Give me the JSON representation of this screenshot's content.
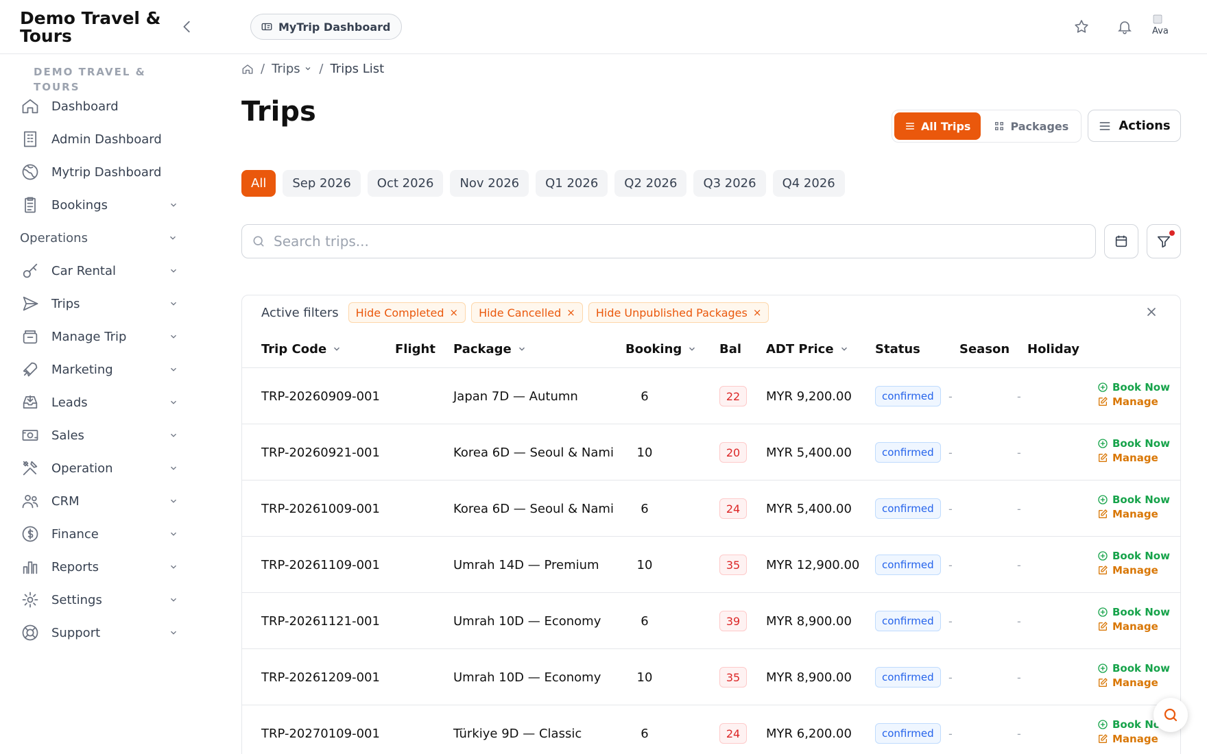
{
  "header": {
    "brand": "Demo Travel & Tours",
    "dashboard_pill": "MyTrip Dashboard",
    "avatar_text": "Ava"
  },
  "sidebar": {
    "org_label": "DEMO TRAVEL & TOURS",
    "items": [
      {
        "label": "Dashboard",
        "icon": "home-icon",
        "chevron": false
      },
      {
        "label": "Admin Dashboard",
        "icon": "building-icon",
        "chevron": false
      },
      {
        "label": "Mytrip Dashboard",
        "icon": "globe-icon",
        "chevron": false
      },
      {
        "label": "Bookings",
        "icon": "clipboard-icon",
        "chevron": true
      },
      {
        "label": "Operations",
        "icon": "",
        "chevron": true,
        "section": true
      },
      {
        "label": "Car Rental",
        "icon": "key-icon",
        "chevron": true
      },
      {
        "label": "Trips",
        "icon": "send-icon",
        "chevron": true
      },
      {
        "label": "Manage Trip",
        "icon": "archive-icon",
        "chevron": true
      },
      {
        "label": "Marketing",
        "icon": "rocket-icon",
        "chevron": true
      },
      {
        "label": "Leads",
        "icon": "inbox-icon",
        "chevron": true
      },
      {
        "label": "Sales",
        "icon": "money-icon",
        "chevron": true
      },
      {
        "label": "Operation",
        "icon": "tools-icon",
        "chevron": true
      },
      {
        "label": "CRM",
        "icon": "users-icon",
        "chevron": true
      },
      {
        "label": "Finance",
        "icon": "dollar-icon",
        "chevron": true
      },
      {
        "label": "Reports",
        "icon": "chart-icon",
        "chevron": true
      },
      {
        "label": "Settings",
        "icon": "gear-icon",
        "chevron": true
      },
      {
        "label": "Support",
        "icon": "lifebuoy-icon",
        "chevron": true
      }
    ]
  },
  "breadcrumb": {
    "trips": "Trips",
    "current": "Trips List"
  },
  "page": {
    "title": "Trips",
    "view_all": "All Trips",
    "view_packages": "Packages",
    "actions": "Actions"
  },
  "period_chips": [
    "All",
    "Sep 2026",
    "Oct 2026",
    "Nov 2026",
    "Q1 2026",
    "Q2 2026",
    "Q3 2026",
    "Q4 2026"
  ],
  "search": {
    "placeholder": "Search trips..."
  },
  "filters": {
    "label": "Active filters",
    "tags": [
      "Hide Completed",
      "Hide Cancelled",
      "Hide Unpublished Packages"
    ]
  },
  "table": {
    "headers": {
      "trip_code": "Trip Code",
      "flight": "Flight",
      "package": "Package",
      "booking": "Booking",
      "bal": "Bal",
      "adt_price": "ADT Price",
      "status": "Status",
      "season": "Season",
      "holiday": "Holiday"
    },
    "book_label": "Book Now",
    "manage_label": "Manage",
    "rows": [
      {
        "code": "TRP-20260909-001",
        "package": "Japan 7D — Autumn",
        "booking": "6",
        "bal": "22",
        "price": "MYR 9,200.00",
        "status": "confirmed",
        "season": "-",
        "holiday": "-"
      },
      {
        "code": "TRP-20260921-001",
        "package": "Korea 6D — Seoul & Nami",
        "booking": "10",
        "bal": "20",
        "price": "MYR 5,400.00",
        "status": "confirmed",
        "season": "-",
        "holiday": "-"
      },
      {
        "code": "TRP-20261009-001",
        "package": "Korea 6D — Seoul & Nami",
        "booking": "6",
        "bal": "24",
        "price": "MYR 5,400.00",
        "status": "confirmed",
        "season": "-",
        "holiday": "-"
      },
      {
        "code": "TRP-20261109-001",
        "package": "Umrah 14D — Premium",
        "booking": "10",
        "bal": "35",
        "price": "MYR 12,900.00",
        "status": "confirmed",
        "season": "-",
        "holiday": "-"
      },
      {
        "code": "TRP-20261121-001",
        "package": "Umrah 10D — Economy",
        "booking": "6",
        "bal": "39",
        "price": "MYR 8,900.00",
        "status": "confirmed",
        "season": "-",
        "holiday": "-"
      },
      {
        "code": "TRP-20261209-001",
        "package": "Umrah 10D — Economy",
        "booking": "10",
        "bal": "35",
        "price": "MYR 8,900.00",
        "status": "confirmed",
        "season": "-",
        "holiday": "-"
      },
      {
        "code": "TRP-20270109-001",
        "package": "Türkiye 9D — Classic",
        "booking": "6",
        "bal": "24",
        "price": "MYR 6,200.00",
        "status": "confirmed",
        "season": "-",
        "holiday": "-"
      }
    ]
  },
  "colors": {
    "accent": "#ea580c",
    "success": "#16a34a",
    "warning": "#d97706",
    "danger": "#dc2626",
    "info": "#2563eb"
  }
}
